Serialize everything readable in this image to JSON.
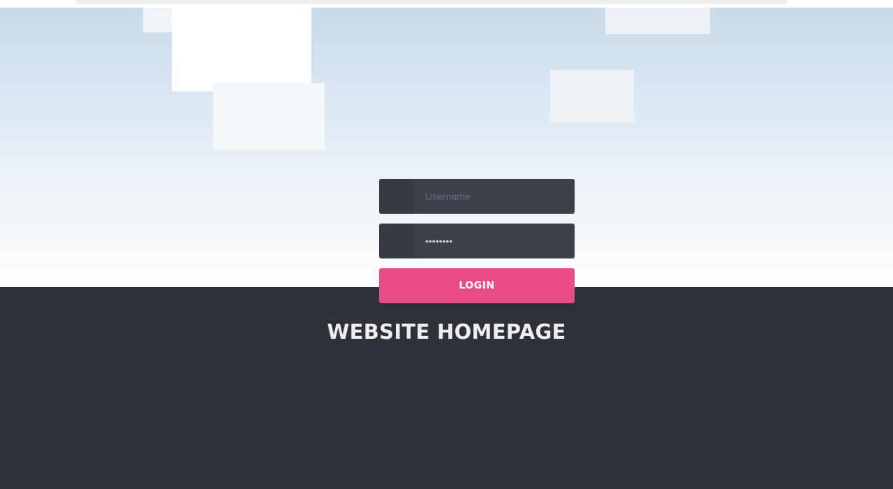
{
  "login": {
    "username_placeholder": "Username",
    "password_value": "password",
    "login_label": "LOGIN"
  },
  "footer": {
    "title": "WEBSITE HOMEPAGE"
  },
  "colors": {
    "sky_top": "#c9dae8",
    "dark_background": "#2d3239",
    "field_background": "#3b4049",
    "accent": "#ea4c88"
  }
}
